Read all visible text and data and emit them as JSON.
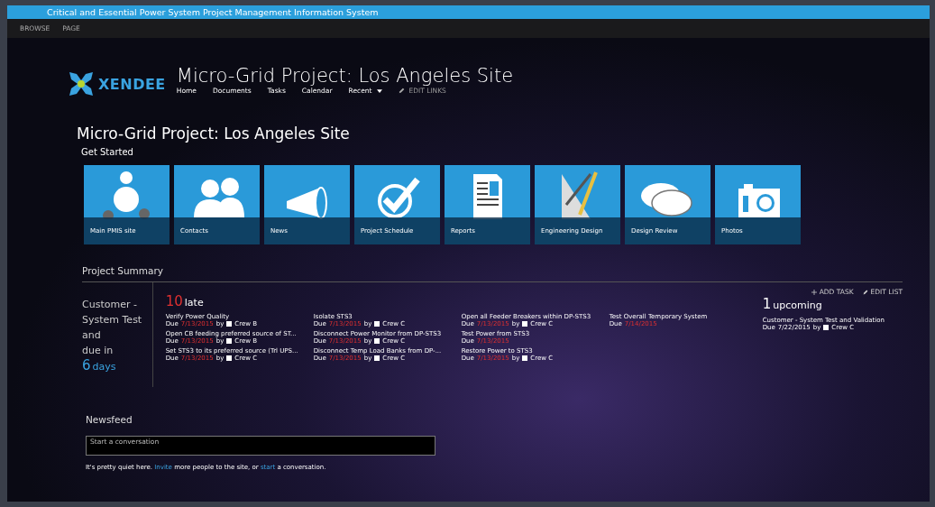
{
  "window": {
    "title": "Critical and Essential Power System Project Management Information System"
  },
  "ribbon_tabs": [
    "BROWSE",
    "PAGE"
  ],
  "logo": {
    "text": "XENDEE"
  },
  "site_title": "Micro-Grid Project: Los Angeles Site",
  "nav": [
    {
      "label": "Home",
      "kind": "link"
    },
    {
      "label": "Documents",
      "kind": "link"
    },
    {
      "label": "Tasks",
      "kind": "link"
    },
    {
      "label": "Calendar",
      "kind": "link"
    },
    {
      "label": "Recent",
      "kind": "menu"
    },
    {
      "label": "EDIT LINKS",
      "kind": "edit"
    }
  ],
  "page_title": "Micro-Grid Project: Los Angeles Site",
  "get_started": "Get Started",
  "tiles": [
    {
      "label": "Main PMIS site"
    },
    {
      "label": "Contacts"
    },
    {
      "label": "News"
    },
    {
      "label": "Project Schedule"
    },
    {
      "label": "Reports"
    },
    {
      "label": "Engineering Design"
    },
    {
      "label": "Design Review"
    },
    {
      "label": "Photos"
    }
  ],
  "summary": {
    "heading": "Project Summary",
    "milestone": [
      "Customer -",
      "System Test",
      "and",
      "due in"
    ],
    "due_count": "6",
    "due_unit": "days",
    "late_count": "10",
    "late_label": "late",
    "upcoming_count": "1",
    "upcoming_label": "upcoming",
    "actions": [
      {
        "label": "ADD TASK",
        "kind": "add"
      },
      {
        "label": "EDIT LIST",
        "kind": "edit"
      }
    ],
    "late_columns": [
      [
        {
          "title": "Verify Power Quality",
          "due_label": "Due",
          "due": "7/13/2015",
          "overdue": true,
          "by": "by",
          "crew": "Crew B",
          "checked": false
        },
        {
          "title": "Open CB feeding preferred source of ST...",
          "due_label": "Due",
          "due": "7/13/2015",
          "overdue": true,
          "by": "by",
          "crew": "Crew B",
          "checked": false
        },
        {
          "title": "Set STS3 to its preferred source (Trl UPS...",
          "due_label": "Due",
          "due": "7/13/2015",
          "overdue": true,
          "by": "by",
          "crew": "Crew C",
          "checked": false
        }
      ],
      [
        {
          "title": "Isolate STS3",
          "due_label": "Due",
          "due": "7/13/2015",
          "overdue": true,
          "by": "by",
          "crew": "Crew C",
          "checked": false
        },
        {
          "title": "Disconnect Power Monitor from DP-STS3",
          "due_label": "Due",
          "due": "7/13/2015",
          "overdue": true,
          "by": "by",
          "crew": "Crew C",
          "checked": false
        },
        {
          "title": "Disconnect Temp Load Banks from DP-...",
          "due_label": "Due",
          "due": "7/13/2015",
          "overdue": true,
          "by": "by",
          "crew": "Crew C",
          "checked": false
        }
      ],
      [
        {
          "title": "Open all Feeder Breakers within DP-STS3",
          "due_label": "Due",
          "due": "7/13/2015",
          "overdue": true,
          "by": "by",
          "crew": "Crew C",
          "checked": false
        },
        {
          "title": "Test Power from STS3",
          "due_label": "Due",
          "due": "7/13/2015",
          "overdue": true
        },
        {
          "title": "Restore Power to STS3",
          "due_label": "Due",
          "due": "7/13/2015",
          "overdue": true,
          "by": "by",
          "crew": "Crew C",
          "checked": false
        }
      ],
      [
        {
          "title": "Test Overall Temporary System",
          "due_label": "Due",
          "due": "7/14/2015",
          "overdue": true
        }
      ]
    ],
    "upcoming": [
      {
        "title": "Customer - System Test and Validation",
        "due_label": "Due",
        "due": "7/22/2015",
        "overdue": false,
        "by": "by",
        "crew": "Crew C",
        "checked": false
      }
    ]
  },
  "newsfeed": {
    "heading": "Newsfeed",
    "placeholder": "Start a conversation",
    "message": [
      "It's pretty quiet here. ",
      "Invite",
      " more people to the site, or ",
      "start",
      " a conversation."
    ]
  }
}
